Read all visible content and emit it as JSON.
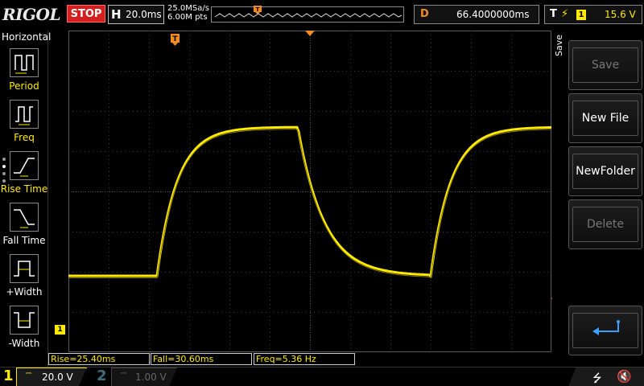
{
  "topbar": {
    "brand": "RIGOL",
    "run_state": "STOP",
    "timebase_label": "H",
    "timebase_value": "20.0ms",
    "sample_rate": "25.0MSa/s",
    "memory_depth": "6.00M pts",
    "delay_label": "D",
    "delay_value": "66.4000000ms",
    "trigger_label": "T",
    "trigger_channel": "1",
    "trigger_level": "15.6 V"
  },
  "left_menu": {
    "title": "Horizontal",
    "items": [
      {
        "label": "Period",
        "icon": "period-icon",
        "active": true
      },
      {
        "label": "Freq",
        "icon": "freq-icon",
        "active": true
      },
      {
        "label": "Rise Time",
        "icon": "rise-time-icon",
        "active": true
      },
      {
        "label": "Fall Time",
        "icon": "fall-time-icon",
        "active": false
      },
      {
        "label": "+Width",
        "icon": "positive-width-icon",
        "active": false
      },
      {
        "label": "-Width",
        "icon": "negative-width-icon",
        "active": false
      }
    ]
  },
  "right_menu": {
    "title": "Save",
    "buttons": [
      {
        "label": "Save",
        "enabled": false
      },
      {
        "label": "New File",
        "enabled": true
      },
      {
        "label": "NewFolder",
        "enabled": true
      },
      {
        "label": "Delete",
        "enabled": false
      }
    ],
    "enter_icon": "enter-return-icon"
  },
  "measurements": [
    {
      "label": "Rise=25.40ms"
    },
    {
      "label": "Fall=30.60ms"
    },
    {
      "label": "Freq=5.36 Hz"
    }
  ],
  "markers": {
    "trigger_position": "T",
    "channel_ground": "1"
  },
  "channels": [
    {
      "number": "1",
      "scale": "20.0 V",
      "coupling_icon": "dc-coupling-icon",
      "color": "#ffea00",
      "enabled": true
    },
    {
      "number": "2",
      "scale": "1.00 V",
      "coupling_icon": "dc-coupling-icon",
      "color": "#3b6e7d",
      "enabled": false
    }
  ],
  "status_icons": [
    "usb-icon",
    "speaker-muted-icon"
  ],
  "colors": {
    "trace": "#ffea00",
    "trigger": "#f28c1e",
    "stop": "#d41f1f"
  },
  "waveform": {
    "type": "line",
    "low_level_div": -2.1,
    "high_level_div": 1.6,
    "rise_start_div": -3.8,
    "rise_tau_div": 0.5,
    "fall_start_div": -0.3,
    "fall_tau_div": 0.65,
    "next_rise_div": 3.0
  }
}
